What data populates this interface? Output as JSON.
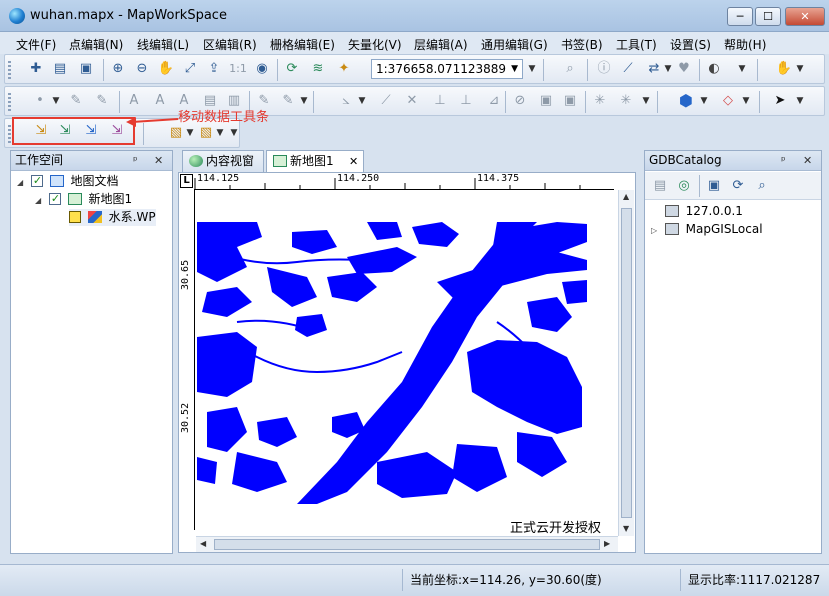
{
  "window": {
    "title": "wuhan.mapx - MapWorkSpace",
    "min_label": "─",
    "max_label": "☐",
    "close_label": "✕"
  },
  "menu": [
    "文件(F)",
    "点编辑(N)",
    "线编辑(L)",
    "区编辑(R)",
    "栅格编辑(E)",
    "矢量化(V)",
    "层编辑(A)",
    "通用编辑(G)",
    "书签(B)",
    "工具(T)",
    "设置(S)",
    "帮助(H)"
  ],
  "toolbar": {
    "scale_value": "1:376658.071123889",
    "one_to_one_label": "1:1"
  },
  "callout": {
    "text": "移动数据工具条",
    "color": "#e53b30"
  },
  "workspace_panel": {
    "title": "工作空间",
    "pin_label": "ᵖ",
    "close_label": "✕",
    "tree": [
      {
        "label": "地图文档",
        "level": 0
      },
      {
        "label": "新地图1",
        "level": 1
      },
      {
        "label": "水系.WP",
        "level": 2
      }
    ]
  },
  "tabs": [
    {
      "label": "内容视窗",
      "active": false
    },
    {
      "label": "新地图1",
      "active": true
    }
  ],
  "tab_close_label": "✕",
  "map": {
    "corner_label": "L",
    "x_ticks": [
      "114.125",
      "114.250",
      "114.375"
    ],
    "y_ticks": [
      "30.65",
      "30.52"
    ],
    "watermark": "正式云开发授权",
    "water_color": "#0000ff"
  },
  "catalog_panel": {
    "title": "GDBCatalog",
    "pin_label": "ᵖ",
    "close_label": "✕",
    "tree": [
      {
        "label": "127.0.0.1"
      },
      {
        "label": "MapGISLocal"
      }
    ]
  },
  "status": {
    "coords": "当前坐标:x=114.26, y=30.60(度)",
    "scale": "显示比率:1117.021287"
  },
  "icons": [
    "new-doc-icon",
    "open-icon",
    "save-icon",
    "zoom-in-icon",
    "zoom-out-icon",
    "pan-icon",
    "full-extent-icon",
    "refresh-icon",
    "eye-icon",
    "layer-icon",
    "magic-wand-icon",
    "info-icon",
    "measure-icon",
    "hand-icon",
    "select-arrow-icon",
    "polygon-icon"
  ]
}
